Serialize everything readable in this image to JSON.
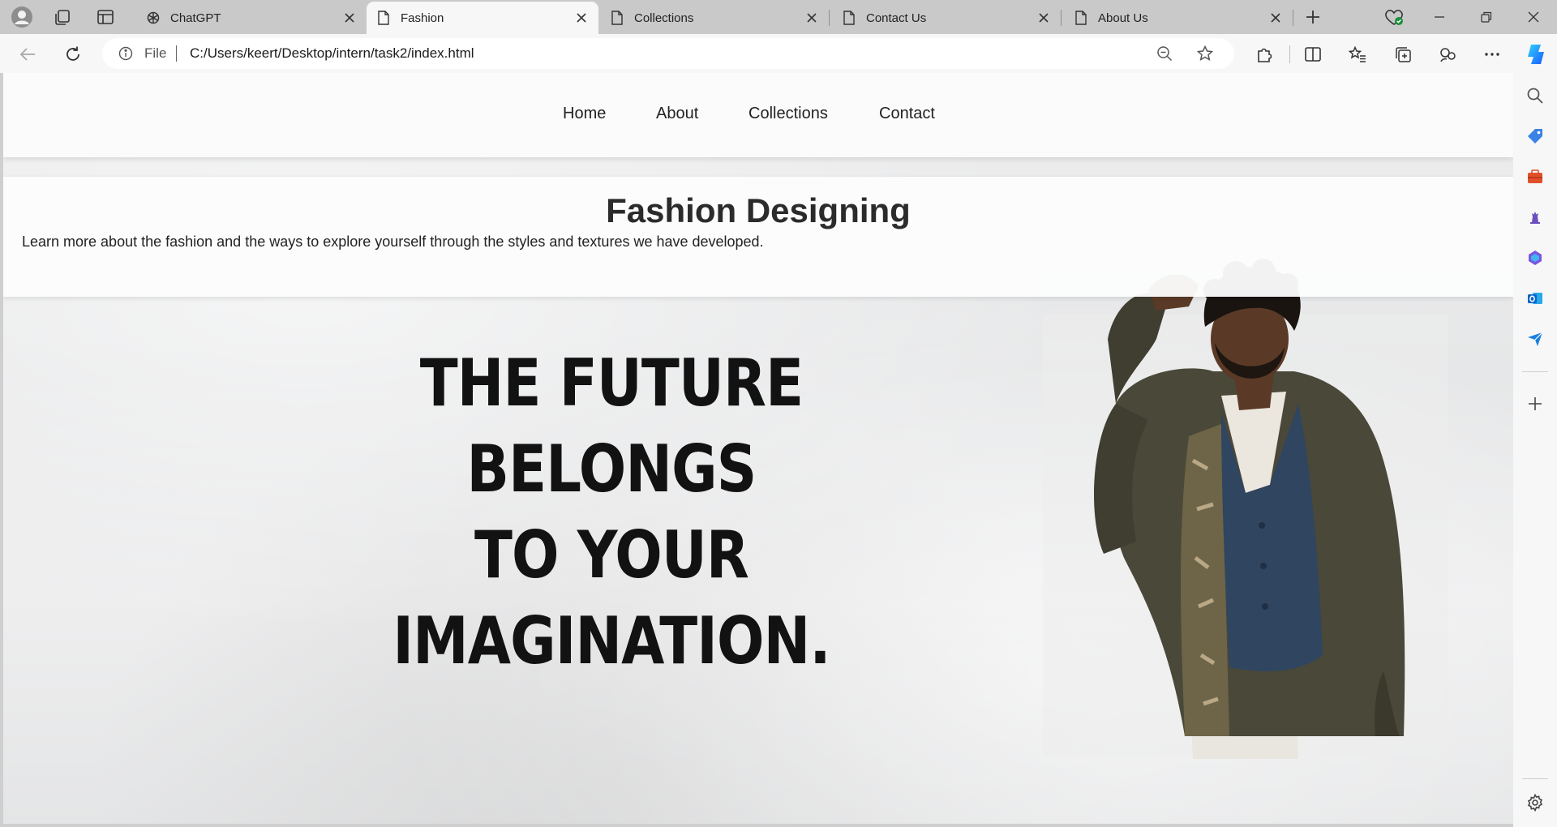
{
  "browser": {
    "tabs": [
      {
        "label": "ChatGPT",
        "icon": "chatgpt-icon",
        "active": false
      },
      {
        "label": "Fashion",
        "icon": "page-icon",
        "active": true
      },
      {
        "label": "Collections",
        "icon": "page-icon",
        "active": false
      },
      {
        "label": "Contact Us",
        "icon": "page-icon",
        "active": false
      },
      {
        "label": "About Us",
        "icon": "page-icon",
        "active": false
      }
    ],
    "address": {
      "scheme_label": "File",
      "url": "C:/Users/keert/Desktop/intern/task2/index.html"
    }
  },
  "page": {
    "nav": [
      "Home",
      "About",
      "Collections",
      "Contact"
    ],
    "title": "Fashion Designing",
    "description": "Learn more about the fashion and the ways to explore yourself through the styles and textures we have developed.",
    "hero_lines": [
      "THE FUTURE",
      "BELONGS",
      "TO YOUR",
      "IMAGINATION."
    ]
  },
  "colors": {
    "tabstrip": "#c9c9c9",
    "toolbar": "#f7f7f7",
    "nav_bg": "#fbfbfb",
    "jacket": "#4a4838",
    "vest": "#2f4560",
    "skin": "#5a3a26",
    "copilot_blue": "#1f8fff"
  }
}
